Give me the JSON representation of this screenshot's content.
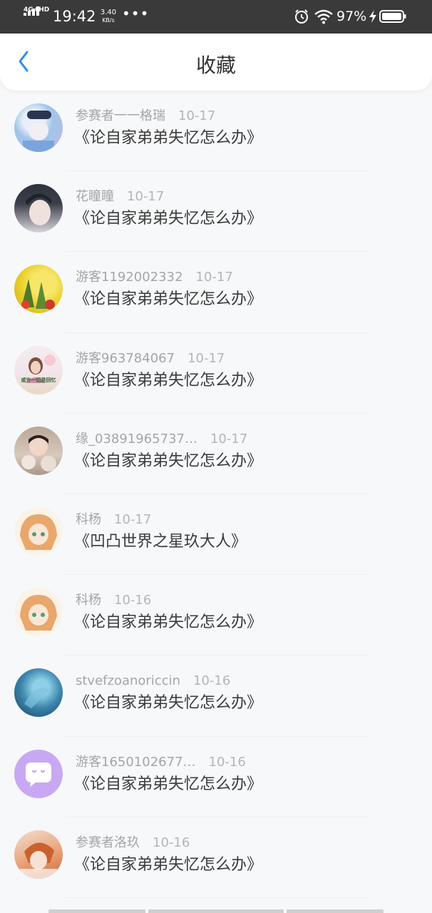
{
  "status_bar": {
    "network": "4G+HD",
    "time": "19:42",
    "speed_value": "3.40",
    "speed_unit": "KB/s",
    "more": "•••",
    "battery_percent": "97%"
  },
  "nav": {
    "back_icon": "chevron-left-icon",
    "title": "收藏",
    "accent": "#2f8cf0"
  },
  "items": [
    {
      "user": "参赛者一一格瑞",
      "date": "10-17",
      "title": "《论自家弟弟失忆怎么办》",
      "avatar_colors": [
        "#9fc6e8",
        "#c9b6ee"
      ]
    },
    {
      "user": "花瞳瞳",
      "date": "10-17",
      "title": "《论自家弟弟失忆怎么办》",
      "avatar_colors": [
        "#3b3f4a",
        "#d9d4dc"
      ]
    },
    {
      "user": "游客1192002332",
      "date": "10-17",
      "title": "《论自家弟弟失忆怎么办》",
      "avatar_colors": [
        "#e9d12a",
        "#4f7a2c"
      ]
    },
    {
      "user": "游客963784067",
      "date": "10-17",
      "title": "《论自家弟弟失忆怎么办》",
      "avatar_colors": [
        "#f2e6ec",
        "#8a6a5a"
      ],
      "avatar_caption": "或许一切是回忆"
    },
    {
      "user": "缘_03891965737…",
      "date": "10-17",
      "title": "《论自家弟弟失忆怎么办》",
      "avatar_colors": [
        "#c8b7aa",
        "#6a5950"
      ]
    },
    {
      "user": "科杨",
      "date": "10-17",
      "title": "《凹凸世界之星玖大人》",
      "avatar_colors": [
        "#fbeed9",
        "#e8a76b"
      ]
    },
    {
      "user": "科杨",
      "date": "10-16",
      "title": "《论自家弟弟失忆怎么办》",
      "avatar_colors": [
        "#fbeed9",
        "#e8a76b"
      ]
    },
    {
      "user": "stvefzoanoriccin",
      "date": "10-16",
      "title": "《论自家弟弟失忆怎么办》",
      "avatar_colors": [
        "#1d4f72",
        "#6fb6d3"
      ]
    },
    {
      "user": "游客1650102677…",
      "date": "10-16",
      "title": "《论自家弟弟失忆怎么办》",
      "avatar_colors": [
        "#c8a8f3",
        "#c8a8f3"
      ]
    },
    {
      "user": "参赛者洛玖",
      "date": "10-16",
      "title": "《论自家弟弟失忆怎么办》",
      "avatar_colors": [
        "#e9a176",
        "#f4ded3"
      ]
    }
  ]
}
